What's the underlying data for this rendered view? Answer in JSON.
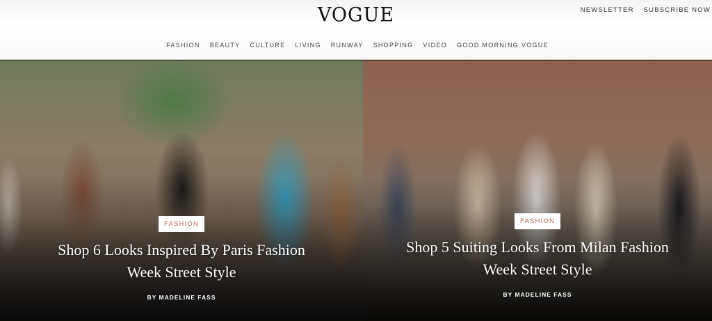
{
  "header": {
    "logo": "VOGUE",
    "top_links": [
      "NEWSLETTER",
      "SUBSCRIBE NOW"
    ],
    "nav": [
      "FASHION",
      "BEAUTY",
      "CULTURE",
      "LIVING",
      "RUNWAY",
      "SHOPPING",
      "VIDEO",
      "GOOD MORNING VOGUE"
    ]
  },
  "stories": [
    {
      "category": "FASHION",
      "headline": "Shop 6 Looks Inspired By Paris Fashion Week Street Style",
      "byline": "BY MADELINE FASS"
    },
    {
      "category": "FASHION",
      "headline": "Shop 5 Suiting Looks From Milan Fashion Week Street Style",
      "byline": "BY MADELINE FASS"
    }
  ]
}
